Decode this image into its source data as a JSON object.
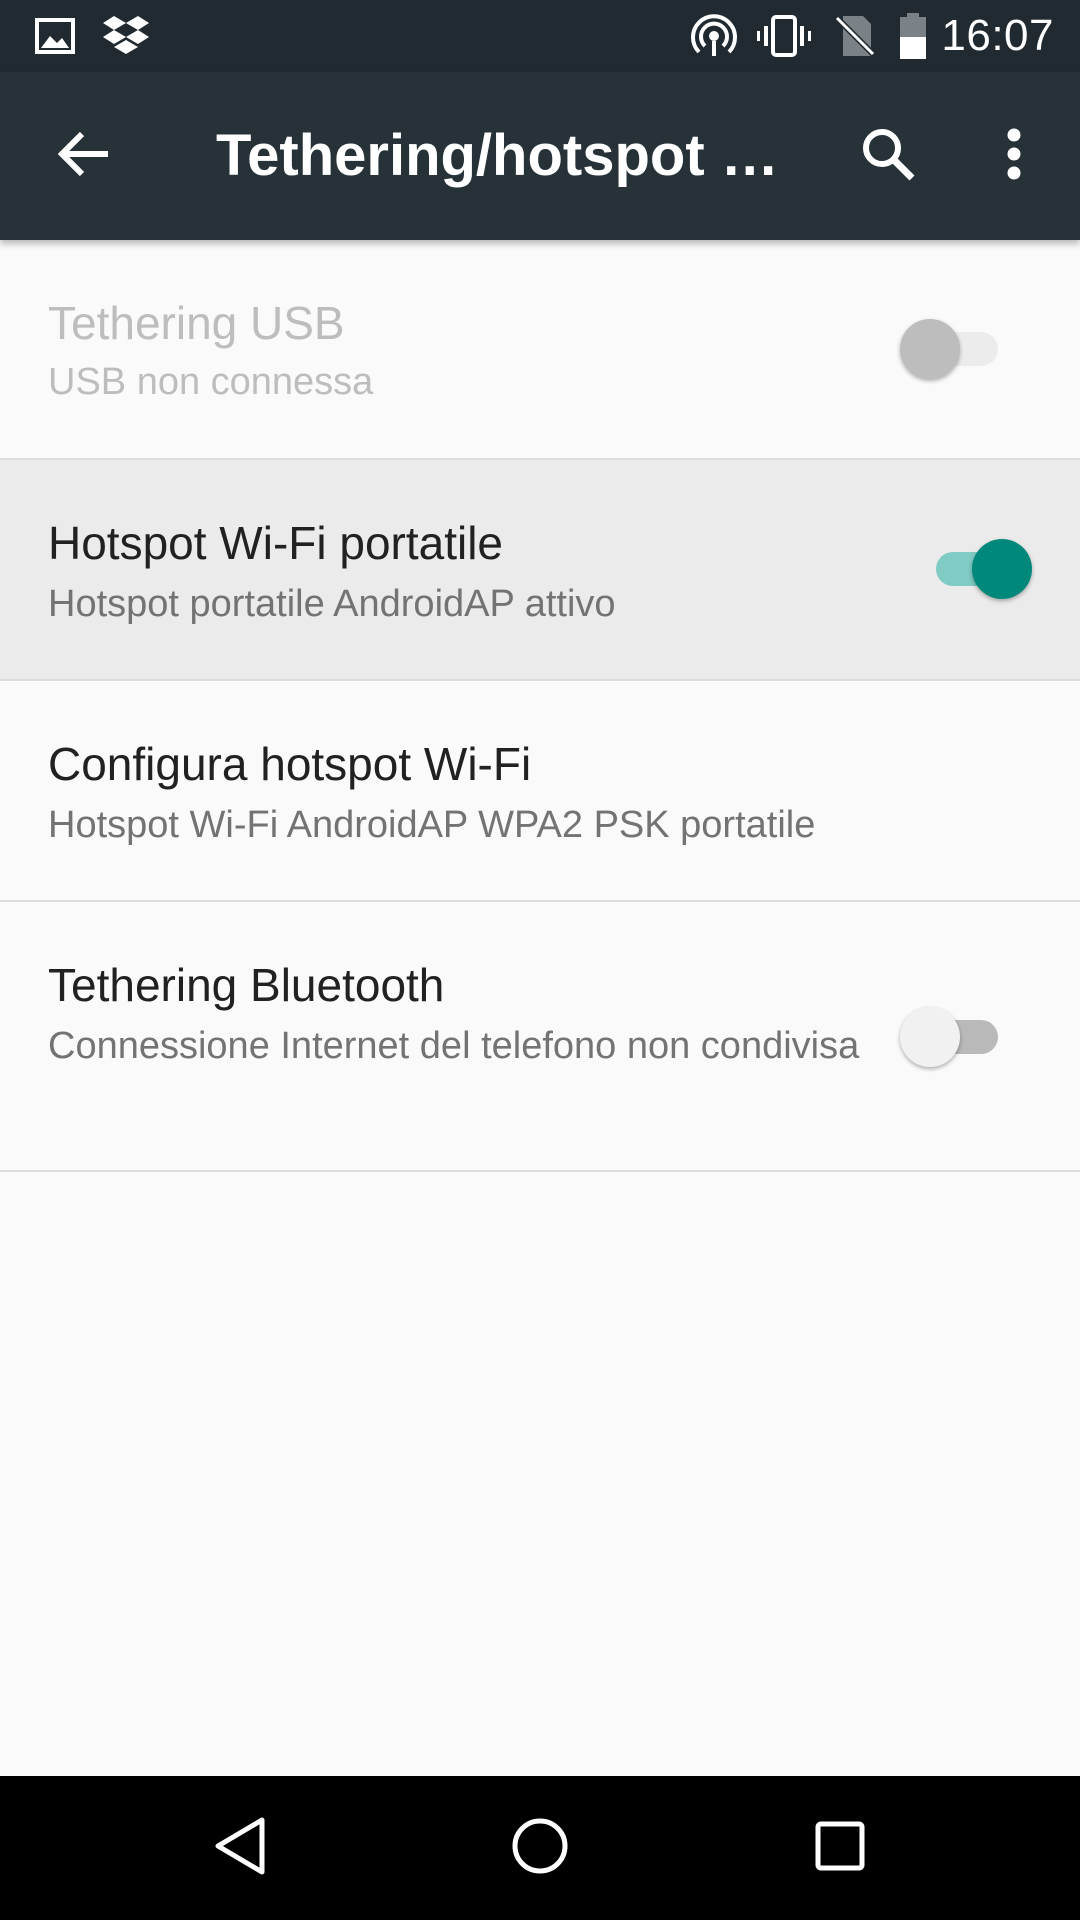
{
  "status_bar": {
    "time": "16:07",
    "icons": [
      "image-icon",
      "dropbox-icon",
      "hotspot-icon",
      "vibrate-icon",
      "no-sim-icon",
      "battery-icon"
    ]
  },
  "app_bar": {
    "title": "Tethering/hotspot p…",
    "actions": [
      "back-arrow-icon",
      "search-icon",
      "more-vert-icon"
    ],
    "background": "#263238"
  },
  "settings": [
    {
      "title": "Tethering USB",
      "summary": "USB non connessa",
      "toggle": "off",
      "enabled": false
    },
    {
      "title": "Hotspot Wi-Fi portatile",
      "summary": "Hotspot portatile AndroidAP attivo",
      "toggle": "on",
      "enabled": true
    },
    {
      "title": "Configura hotspot Wi-Fi",
      "summary": "Hotspot Wi-Fi AndroidAP WPA2 PSK portatile",
      "enabled": true
    },
    {
      "title": "Tethering Bluetooth",
      "summary": "Connessione Internet del telefono non condivisa",
      "toggle": "off",
      "enabled": true
    }
  ],
  "colors": {
    "accent": "#00897b",
    "accent_track": "#80cbc4"
  },
  "nav_bar": {
    "buttons": [
      "back-triangle-icon",
      "home-circle-icon",
      "recents-square-icon"
    ]
  }
}
